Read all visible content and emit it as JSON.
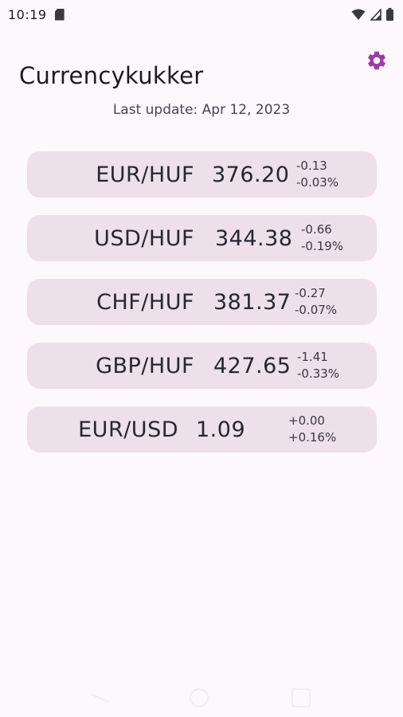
{
  "status_bar": {
    "time": "10:19",
    "icons": [
      "sim-card-icon",
      "wifi-icon",
      "signal-icon",
      "battery-icon"
    ]
  },
  "app": {
    "title": "Currencykukker",
    "settings_icon": "gear-icon",
    "accent_color": "#9c3aa8"
  },
  "last_update": "Last update: Apr 12, 2023",
  "rates": [
    {
      "pair": "EUR/HUF",
      "value": "376.20",
      "change_abs": "-0.13",
      "change_pct": "-0.03%"
    },
    {
      "pair": "USD/HUF",
      "value": "344.38",
      "change_abs": "-0.66",
      "change_pct": "-0.19%"
    },
    {
      "pair": "CHF/HUF",
      "value": "381.37",
      "change_abs": "-0.27",
      "change_pct": "-0.07%"
    },
    {
      "pair": "GBP/HUF",
      "value": "427.65",
      "change_abs": "-1.41",
      "change_pct": "-0.33%"
    },
    {
      "pair": "EUR/USD",
      "value": "1.09",
      "change_abs": "+0.00",
      "change_pct": "+0.16%"
    }
  ],
  "colors": {
    "background": "#fcf8fc",
    "card": "#ede0e8",
    "text": "#1d1b1e"
  },
  "nav_bar": {
    "icons": [
      "back-icon",
      "home-icon",
      "recents-icon"
    ]
  }
}
